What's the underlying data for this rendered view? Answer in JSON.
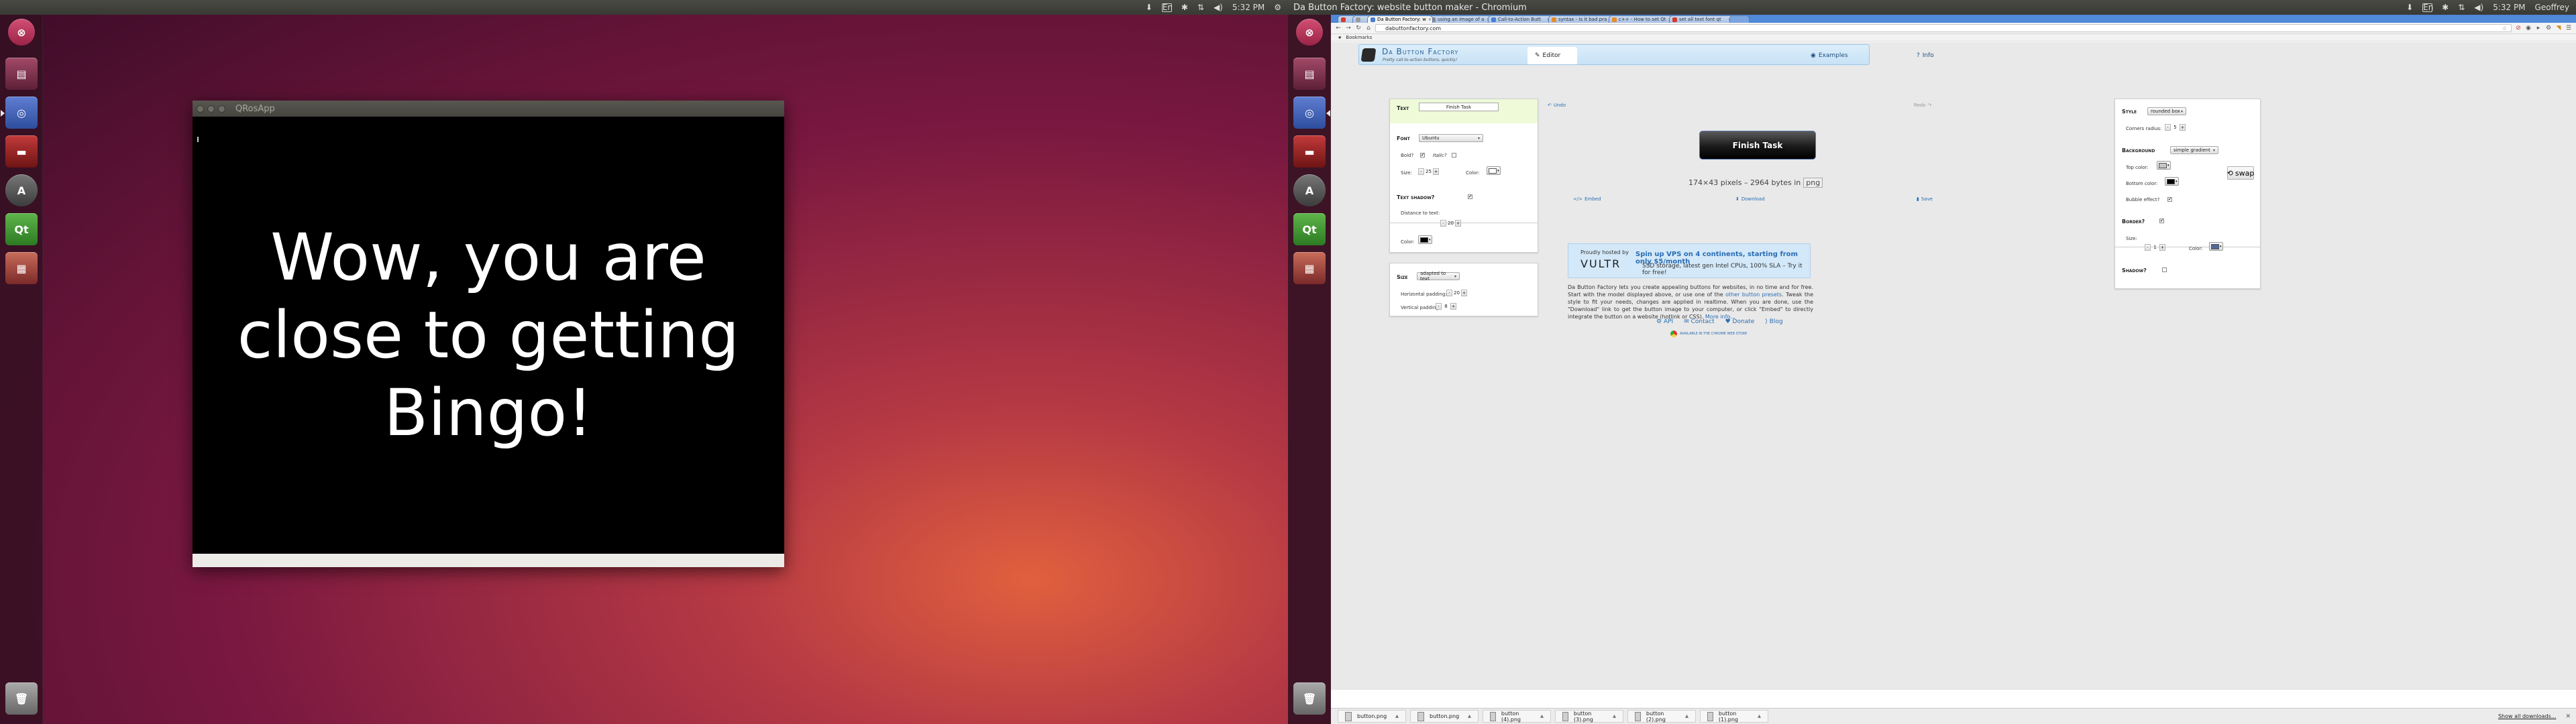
{
  "monitor1": {
    "clock": "5:32 PM",
    "qros_window": {
      "title": "QRosApp",
      "message": "Wow, you are close to getting Bingo!"
    }
  },
  "monitor2": {
    "window_title": "Da Button Factory: website button maker - Chromium",
    "clock": "5:32 PM",
    "user": "Geoffrey",
    "browser": {
      "tabs": [
        {
          "label": "Da Button Factory: w",
          "active": true,
          "color": "#4a7fd0"
        },
        {
          "label": "using an image of a",
          "active": false,
          "color": "#888888"
        },
        {
          "label": "Call-to-Action Butt",
          "active": false,
          "color": "#4a7fd0"
        },
        {
          "label": "syntax - Is it bad pra",
          "active": false,
          "color": "#e88a2a"
        },
        {
          "label": "c++ - How to set Qt",
          "active": false,
          "color": "#e88a2a"
        },
        {
          "label": "set all text font qt",
          "active": false,
          "color": "#d23b2a"
        }
      ],
      "url": "dabuttonfactory.com",
      "bookmarks_label": "Bookmarks",
      "downloads": [
        "button.png",
        "button.png",
        "button (4).png",
        "button (3).png",
        "button (2).png",
        "button (1).png"
      ],
      "show_all_downloads": "Show all downloads..."
    },
    "site": {
      "title": "Da Button Factory",
      "subtitle": "Pretty call-to-action buttons, quickly!",
      "nav": {
        "editor": "Editor",
        "examples": "Examples",
        "info": "Info"
      },
      "text_section": {
        "heading": "Text",
        "value": "Finish Task"
      },
      "font_section": {
        "heading": "Font",
        "font": "Ubuntu",
        "bold_label": "Bold?",
        "bold": "✔",
        "italic_label": "Italic?",
        "size_label": "Size:",
        "size": "25",
        "color_label": "Color:",
        "color": "#ffffff"
      },
      "shadow_section": {
        "heading": "Text shadow?",
        "checked": "✔",
        "distance_label": "Distance to text:",
        "distance": "20",
        "color_label": "Color:",
        "color": "#000000"
      },
      "size_section": {
        "heading": "Size",
        "mode": "adapted to text",
        "hpad_label": "Horizontal padding:",
        "hpad": "20",
        "vpad_label": "Vertical padding:",
        "vpad": "8"
      },
      "preview": {
        "undo": "Undo",
        "redo": "Redo",
        "button_text": "Finish Task",
        "info_text": "174×43 pixels – 2964 bytes in",
        "format": "png",
        "embed": "Embed",
        "download": "Download",
        "save": "Save"
      },
      "style_section": {
        "heading": "Style",
        "style": "rounded box",
        "corners_label": "Corners radius:",
        "corners": "5"
      },
      "background_section": {
        "heading": "Background",
        "mode": "simple gradient",
        "top_label": "Top color:",
        "top_color": "#c6c6c6",
        "bottom_label": "Bottom color:",
        "bottom_color": "#000000",
        "bubble_label": "Bubble effect?",
        "bubble": "✔",
        "swap": "swap"
      },
      "border_section": {
        "heading": "Border?",
        "checked": "✔",
        "size_label": "Size:",
        "size": "1",
        "color_label": "Color:",
        "color": "#55689a"
      },
      "shadow2_section": {
        "heading": "Shadow?"
      },
      "ad": {
        "hosted": "Proudly hosted by",
        "brand": "VULTR",
        "headline": "Spin up VPS on 4 continents, starting from only $5/month",
        "sub": "SSD storage, latest gen Intel CPUs, 100% SLA – Try it for free!"
      },
      "description": {
        "p1": "Da Button Factory lets you create appealing buttons for websites, in no time and for free. Start with the model displayed above, or use one of the",
        "link1": "other button presets",
        "p2": ". Tweak the style to fit your needs, changes are applied in realtime. When you are done, use the \"Download\" link to get the button image to your computer, or click \"Embed\" to directly integrate the button on a website (hotlink or CSS).",
        "link2": "More info..."
      },
      "footer": {
        "api": "API",
        "contact": "Contact",
        "donate": "Donate",
        "blog": "Blog",
        "store": "AVAILABLE IN THE CHROME WEB STORE"
      }
    }
  }
}
